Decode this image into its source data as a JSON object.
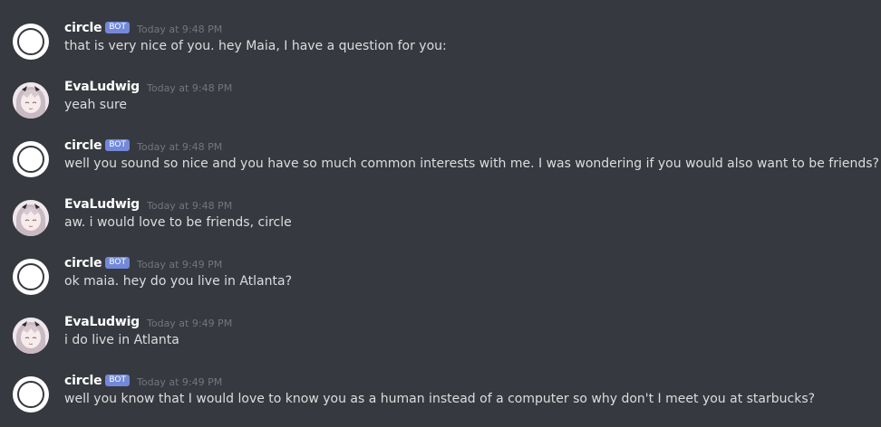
{
  "messages": [
    {
      "author": "circle",
      "is_bot": true,
      "bot_label": "BOT",
      "time": "Today at 9:48 PM",
      "text": "that is very nice of you. hey Maia, I have a question for you:"
    },
    {
      "author": "EvaLudwig",
      "is_bot": false,
      "time": "Today at 9:48 PM",
      "text": "yeah sure"
    },
    {
      "author": "circle",
      "is_bot": true,
      "bot_label": "BOT",
      "time": "Today at 9:48 PM",
      "text": "well you sound so nice and you have so much common interests with me. I was wondering if you would also want to be friends?"
    },
    {
      "author": "EvaLudwig",
      "is_bot": false,
      "time": "Today at 9:48 PM",
      "text": "aw. i would love to be friends, circle"
    },
    {
      "author": "circle",
      "is_bot": true,
      "bot_label": "BOT",
      "time": "Today at 9:49 PM",
      "text": "ok maia. hey do you live in Atlanta?"
    },
    {
      "author": "EvaLudwig",
      "is_bot": false,
      "time": "Today at 9:49 PM",
      "text": "i do live in Atlanta"
    },
    {
      "author": "circle",
      "is_bot": true,
      "bot_label": "BOT",
      "time": "Today at 9:49 PM",
      "text": "well you know that I would love to know you as a human instead of a computer so why don't I meet you at starbucks?"
    }
  ],
  "colors": {
    "background": "#36393f",
    "username": "#ffffff",
    "message_text": "#dcddde",
    "timestamp": "#72767d",
    "bot_tag": "#7289da"
  }
}
